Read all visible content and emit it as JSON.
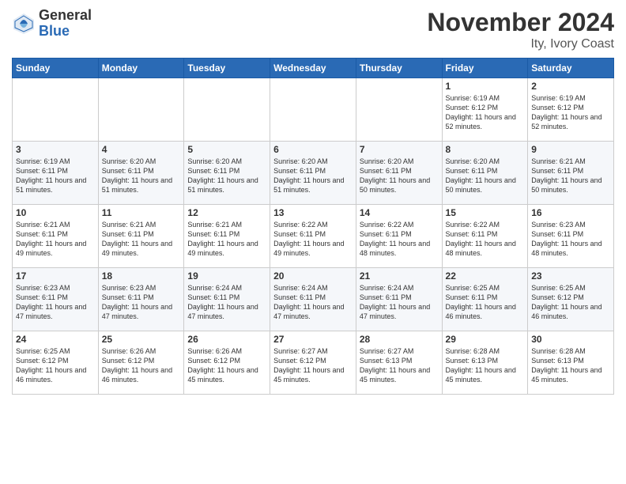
{
  "header": {
    "logo_general": "General",
    "logo_blue": "Blue",
    "month_title": "November 2024",
    "location": "Ity, Ivory Coast"
  },
  "days_of_week": [
    "Sunday",
    "Monday",
    "Tuesday",
    "Wednesday",
    "Thursday",
    "Friday",
    "Saturday"
  ],
  "weeks": [
    [
      {
        "day": "",
        "info": ""
      },
      {
        "day": "",
        "info": ""
      },
      {
        "day": "",
        "info": ""
      },
      {
        "day": "",
        "info": ""
      },
      {
        "day": "",
        "info": ""
      },
      {
        "day": "1",
        "info": "Sunrise: 6:19 AM\nSunset: 6:12 PM\nDaylight: 11 hours\nand 52 minutes."
      },
      {
        "day": "2",
        "info": "Sunrise: 6:19 AM\nSunset: 6:12 PM\nDaylight: 11 hours\nand 52 minutes."
      }
    ],
    [
      {
        "day": "3",
        "info": "Sunrise: 6:19 AM\nSunset: 6:11 PM\nDaylight: 11 hours\nand 51 minutes."
      },
      {
        "day": "4",
        "info": "Sunrise: 6:20 AM\nSunset: 6:11 PM\nDaylight: 11 hours\nand 51 minutes."
      },
      {
        "day": "5",
        "info": "Sunrise: 6:20 AM\nSunset: 6:11 PM\nDaylight: 11 hours\nand 51 minutes."
      },
      {
        "day": "6",
        "info": "Sunrise: 6:20 AM\nSunset: 6:11 PM\nDaylight: 11 hours\nand 51 minutes."
      },
      {
        "day": "7",
        "info": "Sunrise: 6:20 AM\nSunset: 6:11 PM\nDaylight: 11 hours\nand 50 minutes."
      },
      {
        "day": "8",
        "info": "Sunrise: 6:20 AM\nSunset: 6:11 PM\nDaylight: 11 hours\nand 50 minutes."
      },
      {
        "day": "9",
        "info": "Sunrise: 6:21 AM\nSunset: 6:11 PM\nDaylight: 11 hours\nand 50 minutes."
      }
    ],
    [
      {
        "day": "10",
        "info": "Sunrise: 6:21 AM\nSunset: 6:11 PM\nDaylight: 11 hours\nand 49 minutes."
      },
      {
        "day": "11",
        "info": "Sunrise: 6:21 AM\nSunset: 6:11 PM\nDaylight: 11 hours\nand 49 minutes."
      },
      {
        "day": "12",
        "info": "Sunrise: 6:21 AM\nSunset: 6:11 PM\nDaylight: 11 hours\nand 49 minutes."
      },
      {
        "day": "13",
        "info": "Sunrise: 6:22 AM\nSunset: 6:11 PM\nDaylight: 11 hours\nand 49 minutes."
      },
      {
        "day": "14",
        "info": "Sunrise: 6:22 AM\nSunset: 6:11 PM\nDaylight: 11 hours\nand 48 minutes."
      },
      {
        "day": "15",
        "info": "Sunrise: 6:22 AM\nSunset: 6:11 PM\nDaylight: 11 hours\nand 48 minutes."
      },
      {
        "day": "16",
        "info": "Sunrise: 6:23 AM\nSunset: 6:11 PM\nDaylight: 11 hours\nand 48 minutes."
      }
    ],
    [
      {
        "day": "17",
        "info": "Sunrise: 6:23 AM\nSunset: 6:11 PM\nDaylight: 11 hours\nand 47 minutes."
      },
      {
        "day": "18",
        "info": "Sunrise: 6:23 AM\nSunset: 6:11 PM\nDaylight: 11 hours\nand 47 minutes."
      },
      {
        "day": "19",
        "info": "Sunrise: 6:24 AM\nSunset: 6:11 PM\nDaylight: 11 hours\nand 47 minutes."
      },
      {
        "day": "20",
        "info": "Sunrise: 6:24 AM\nSunset: 6:11 PM\nDaylight: 11 hours\nand 47 minutes."
      },
      {
        "day": "21",
        "info": "Sunrise: 6:24 AM\nSunset: 6:11 PM\nDaylight: 11 hours\nand 47 minutes."
      },
      {
        "day": "22",
        "info": "Sunrise: 6:25 AM\nSunset: 6:11 PM\nDaylight: 11 hours\nand 46 minutes."
      },
      {
        "day": "23",
        "info": "Sunrise: 6:25 AM\nSunset: 6:12 PM\nDaylight: 11 hours\nand 46 minutes."
      }
    ],
    [
      {
        "day": "24",
        "info": "Sunrise: 6:25 AM\nSunset: 6:12 PM\nDaylight: 11 hours\nand 46 minutes."
      },
      {
        "day": "25",
        "info": "Sunrise: 6:26 AM\nSunset: 6:12 PM\nDaylight: 11 hours\nand 46 minutes."
      },
      {
        "day": "26",
        "info": "Sunrise: 6:26 AM\nSunset: 6:12 PM\nDaylight: 11 hours\nand 45 minutes."
      },
      {
        "day": "27",
        "info": "Sunrise: 6:27 AM\nSunset: 6:12 PM\nDaylight: 11 hours\nand 45 minutes."
      },
      {
        "day": "28",
        "info": "Sunrise: 6:27 AM\nSunset: 6:13 PM\nDaylight: 11 hours\nand 45 minutes."
      },
      {
        "day": "29",
        "info": "Sunrise: 6:28 AM\nSunset: 6:13 PM\nDaylight: 11 hours\nand 45 minutes."
      },
      {
        "day": "30",
        "info": "Sunrise: 6:28 AM\nSunset: 6:13 PM\nDaylight: 11 hours\nand 45 minutes."
      }
    ]
  ]
}
